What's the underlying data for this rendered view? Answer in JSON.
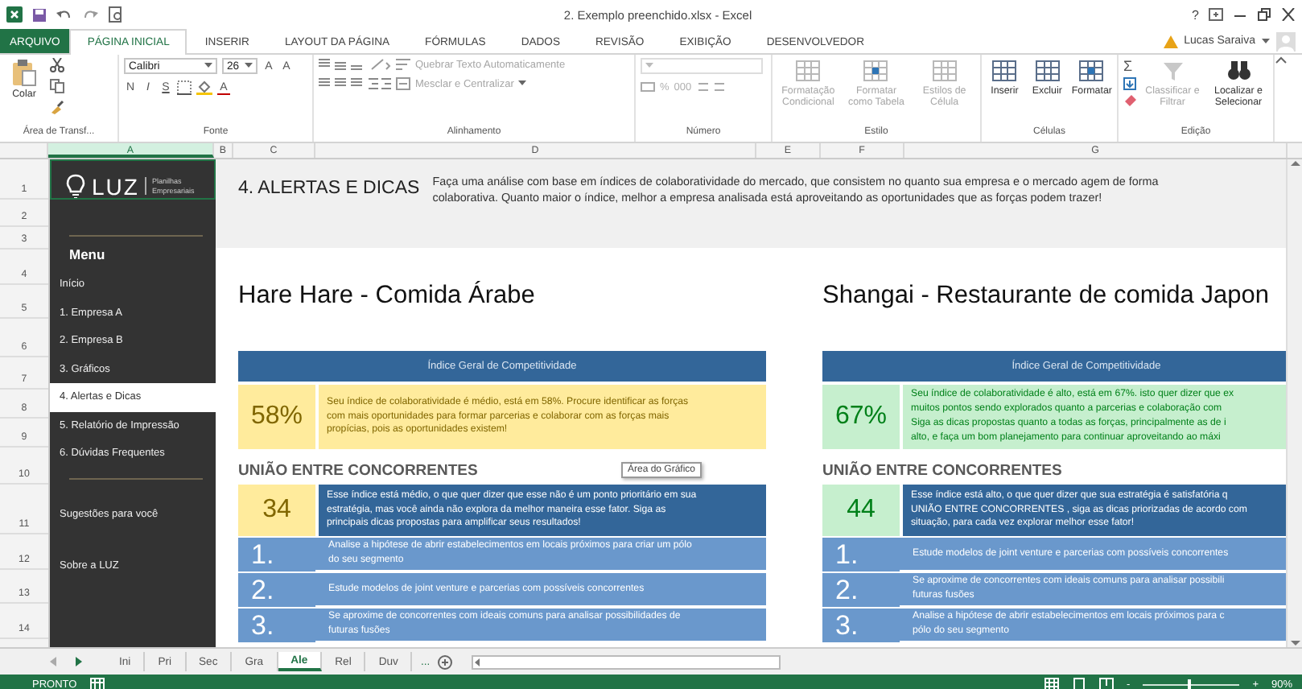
{
  "title_bar": {
    "title": "2. Exemplo preenchido.xlsx - Excel",
    "help": "?"
  },
  "ribbon_tabs": [
    {
      "label": "ARQUIVO",
      "kind": "file",
      "selected": false
    },
    {
      "label": "PÁGINA INICIAL",
      "kind": "tab",
      "selected": true
    },
    {
      "label": "INSERIR",
      "kind": "tab",
      "selected": false
    },
    {
      "label": "LAYOUT DA PÁGINA",
      "kind": "tab",
      "selected": false
    },
    {
      "label": "FÓRMULAS",
      "kind": "tab",
      "selected": false
    },
    {
      "label": "DADOS",
      "kind": "tab",
      "selected": false
    },
    {
      "label": "REVISÃO",
      "kind": "tab",
      "selected": false
    },
    {
      "label": "EXIBIÇÃO",
      "kind": "tab",
      "selected": false
    },
    {
      "label": "DESENVOLVEDOR",
      "kind": "tab",
      "selected": false
    }
  ],
  "user": {
    "name": "Lucas Saraiva"
  },
  "ribbon_groups": [
    {
      "label": "Área de Transf...",
      "kind": "clipboard",
      "items": [
        {
          "label": "Colar",
          "disabled": false
        }
      ]
    },
    {
      "label": "Fonte",
      "kind": "font",
      "font": "Calibri",
      "size": "26",
      "size_buttons": [
        "A",
        "A"
      ],
      "styles": [
        "N",
        "I",
        "S"
      ],
      "font_color": "A"
    },
    {
      "label": "Alinhamento",
      "kind": "alignment",
      "items": [
        {
          "label": "Quebrar Texto Automaticamente",
          "disabled": true
        },
        {
          "label": "Mesclar e Centralizar",
          "disabled": true
        }
      ]
    },
    {
      "label": "Número",
      "kind": "number",
      "symbols": [
        "%",
        "000"
      ],
      "disabled": true
    },
    {
      "label": "Estilo",
      "kind": "large",
      "items": [
        {
          "label": "Formatação Condicional",
          "disabled": true
        },
        {
          "label": "Formatar como Tabela",
          "disabled": true
        },
        {
          "label": "Estilos de Célula",
          "disabled": true
        }
      ]
    },
    {
      "label": "Células",
      "kind": "large",
      "items": [
        {
          "label": "Inserir",
          "disabled": false
        },
        {
          "label": "Excluir",
          "disabled": false
        },
        {
          "label": "Formatar",
          "disabled": false
        }
      ]
    },
    {
      "label": "Edição",
      "kind": "editing",
      "symbol": "Σ",
      "items": [
        {
          "label": "Classificar e Filtrar",
          "disabled": true
        },
        {
          "label": "Localizar e Selecionar",
          "disabled": false
        }
      ]
    }
  ],
  "columns": [
    {
      "label": "A",
      "selected": true
    },
    {
      "label": "B",
      "selected": false
    },
    {
      "label": "C",
      "selected": false
    },
    {
      "label": "D",
      "selected": false
    },
    {
      "label": "E",
      "selected": false
    },
    {
      "label": "F",
      "selected": false
    },
    {
      "label": "G",
      "selected": false
    }
  ],
  "rows": [
    "1",
    "2",
    "3",
    "4",
    "5",
    "6",
    "7",
    "8",
    "9",
    "10",
    "11",
    "12",
    "13",
    "14"
  ],
  "sidebar": {
    "logo": "LUZ",
    "tagline": "Planilhas Empresariais",
    "menu_title": "Menu",
    "items": [
      {
        "label": "Início",
        "kind": "item",
        "selected": false
      },
      {
        "label": "1. Empresa A",
        "kind": "item",
        "selected": false
      },
      {
        "label": "2. Empresa B",
        "kind": "item",
        "selected": false
      },
      {
        "label": "3. Gráficos",
        "kind": "item",
        "selected": false
      },
      {
        "label": "4. Alertas e Dicas",
        "kind": "item",
        "selected": true
      },
      {
        "label": "5. Relatório de Impressão",
        "kind": "item",
        "selected": false
      },
      {
        "label": "6. Dúvidas Frequentes",
        "kind": "item",
        "selected": false
      },
      {
        "label": "Sugestões para você",
        "kind": "extra",
        "selected": false
      },
      {
        "label": "Sobre a LUZ",
        "kind": "extra",
        "selected": false
      }
    ]
  },
  "header": {
    "title": "4. ALERTAS E DICAS",
    "text": "Faça uma análise com base em índices de colaboratividade do mercado, que consistem no quanto sua empresa e o mercado agem de forma colaborativa. Quanto maior o índice, melhor a empresa analisada está aproveitando as oportunidades que as forças podem trazer!"
  },
  "companies": [
    {
      "name": "Hare Hare - Comida Árabe",
      "index_title": "Índice Geral de Competitividade",
      "score": "58%",
      "color": "#ffeb9c",
      "message": [
        "Seu índice de colaboratividade é médio, está em 58%. Procure identificar as forças",
        "com mais oportunidades para formar parcerias e colaborar com as forças mais",
        "propícias, pois as oportunidades existem!"
      ],
      "section": {
        "title": "UNIÃO ENTRE CONCORRENTES",
        "score": "34",
        "color": "#ffeb9c",
        "message": [
          "Esse índice está médio, o que quer dizer que esse não é um ponto prioritário em sua",
          "estratégia, mas você ainda não explora da melhor maneira esse fator. Siga as",
          "principais dicas propostas para amplificar seus resultados!"
        ],
        "tips": [
          {
            "number": "1.",
            "lines": [
              "Analise a hipótese de abrir estabelecimentos em locais próximos para criar um pólo",
              "do seu segmento"
            ]
          },
          {
            "number": "2.",
            "lines": [
              "Estude modelos de joint venture e parcerias com possíveis concorrentes"
            ]
          },
          {
            "number": "3.",
            "lines": [
              "Se aproxime de concorrentes com ideais comuns para analisar possibilidades de",
              "futuras fusões"
            ]
          }
        ]
      }
    },
    {
      "name": "Shangai - Restaurante de comida Japon",
      "index_title": "Índice Geral de Competitividade",
      "score": "67%",
      "color": "#c6efce",
      "message": [
        "Seu índice de colaboratividade é alto, está em 67%. isto quer dizer que ex",
        "muitos pontos sendo explorados quanto a parcerias e colaboração com",
        "Siga as dicas propostas quanto a todas as forças, principalmente as de i",
        "alto, e faça um bom planejamento para continuar aproveitando ao máxi"
      ],
      "section": {
        "title": "UNIÃO ENTRE CONCORRENTES",
        "score": "44",
        "color": "#c6efce",
        "message": [
          "Esse índice está alto, o que quer dizer que sua estratégia é satisfatória q",
          "UNIÃO ENTRE CONCORRENTES , siga as dicas priorizadas de acordo com",
          "situação, para cada vez explorar melhor esse fator!"
        ],
        "tips": [
          {
            "number": "1.",
            "lines": [
              "Estude modelos de joint venture e parcerias com possíveis concorrentes"
            ]
          },
          {
            "number": "2.",
            "lines": [
              "Se aproxime de concorrentes com ideais comuns para analisar possibili",
              "futuras fusões"
            ]
          },
          {
            "number": "3.",
            "lines": [
              "Analise a hipótese de abrir estabelecimentos em locais próximos para c",
              "pólo do seu segmento"
            ]
          }
        ]
      }
    }
  ],
  "tooltip": "Área do Gráfico",
  "sheet_tabs": [
    {
      "label": "Ini",
      "selected": false
    },
    {
      "label": "Pri",
      "selected": false
    },
    {
      "label": "Sec",
      "selected": false
    },
    {
      "label": "Gra",
      "selected": false
    },
    {
      "label": "Ale",
      "selected": true
    },
    {
      "label": "Rel",
      "selected": false
    },
    {
      "label": "Duv",
      "selected": false
    }
  ],
  "more_tabs": "...",
  "status_bar": {
    "status": "PRONTO",
    "zoom": {
      "minus": "-",
      "plus": "+",
      "level": 0.47,
      "reading": "90%"
    }
  }
}
